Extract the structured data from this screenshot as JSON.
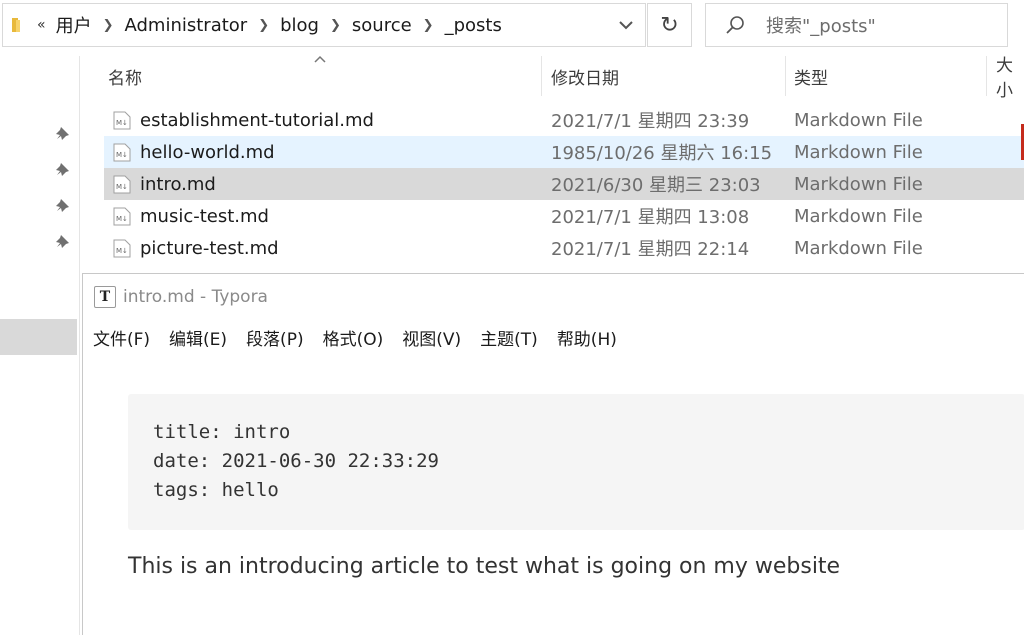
{
  "explorer": {
    "address": {
      "overflow": "«",
      "crumbs": [
        "用户",
        "Administrator",
        "blog",
        "source",
        "_posts"
      ]
    },
    "search_placeholder": "搜索\"_posts\"",
    "columns": {
      "name": "名称",
      "date": "修改日期",
      "type": "类型",
      "size": "大小"
    },
    "files": [
      {
        "name": "establishment-tutorial.md",
        "date": "2021/7/1 星期四 23:39",
        "type": "Markdown File"
      },
      {
        "name": "hello-world.md",
        "date": "1985/10/26 星期六 16:15",
        "type": "Markdown File"
      },
      {
        "name": "intro.md",
        "date": "2021/6/30 星期三 23:03",
        "type": "Markdown File"
      },
      {
        "name": "music-test.md",
        "date": "2021/7/1 星期四 13:08",
        "type": "Markdown File"
      },
      {
        "name": "picture-test.md",
        "date": "2021/7/1 星期四 22:14",
        "type": "Markdown File"
      }
    ]
  },
  "typora": {
    "app_icon": "T",
    "title": "intro.md - Typora",
    "menu": [
      "文件(F)",
      "编辑(E)",
      "段落(P)",
      "格式(O)",
      "视图(V)",
      "主题(T)",
      "帮助(H)"
    ],
    "front_matter": [
      "title: intro",
      "date: 2021-06-30 22:33:29",
      "tags: hello"
    ],
    "paragraph": "This is an introducing article to test what is going on my website"
  }
}
